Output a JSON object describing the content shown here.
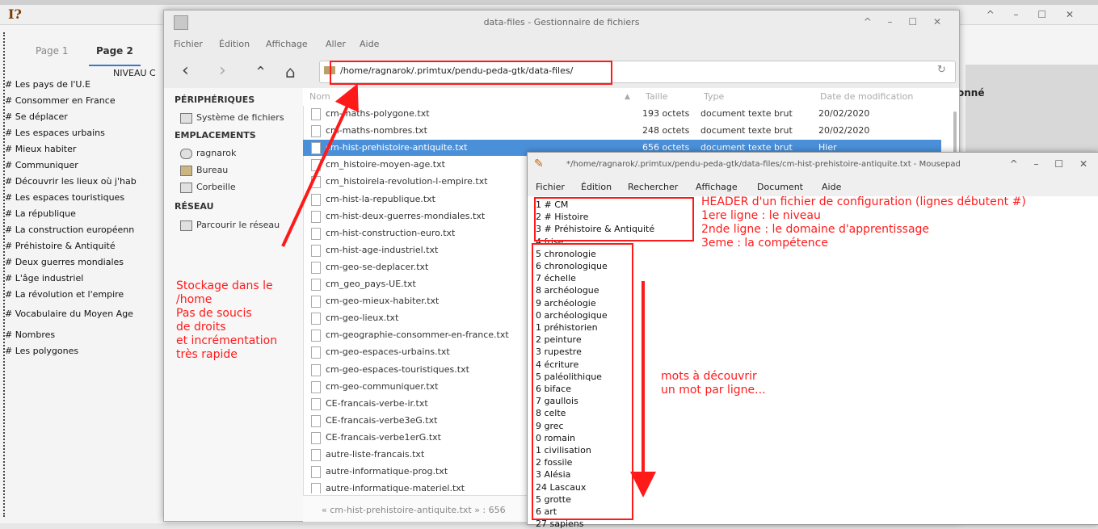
{
  "app": {
    "logo": "I?",
    "controls": "^ – ☐ ✕",
    "tabs": [
      "Page 1",
      "Page 2"
    ],
    "level_label": "NIVEAU C",
    "list_items": [
      "# Les pays de l'U.E",
      "# Consommer en France",
      "# Se déplacer",
      "# Les espaces urbains",
      "# Mieux habiter",
      "# Communiquer",
      "# Découvrir les  lieux où j'hab",
      "# Les espaces touristiques",
      "# La république",
      "# La construction européenn",
      "# Préhistoire & Antiquité",
      "# Deux guerres mondiales",
      "# L'âge industriel",
      "# La révolution et l'empire",
      "# Vocabulaire du Moyen Age",
      "# Nombres",
      "# Les polygones"
    ],
    "right_label": "onné"
  },
  "file_manager": {
    "title": "data-files - Gestionnaire de fichiers",
    "controls": "^ – ☐ ✕",
    "menu": [
      "Fichier",
      "Édition",
      "Affichage",
      "Aller",
      "Aide"
    ],
    "nav": {
      "back": "‹",
      "forward": "›",
      "up": "⌃",
      "home": "⌂"
    },
    "path": "/home/ragnarok/.primtux/pendu-peda-gtk/data-files/",
    "sidebar": {
      "devices_header": "PÉRIPHÉRIQUES",
      "devices": [
        "Système de fichiers"
      ],
      "places_header": "EMPLACEMENTS",
      "places": [
        "ragnarok",
        "Bureau",
        "Corbeille"
      ],
      "network_header": "RÉSEAU",
      "network": [
        "Parcourir le réseau"
      ]
    },
    "columns": [
      "Nom",
      "Taille",
      "Type",
      "Date de modification"
    ],
    "files": [
      {
        "name": "cm-maths-polygone.txt",
        "size": "193 octets",
        "type": "document texte brut",
        "date": "20/02/2020"
      },
      {
        "name": "cm-maths-nombres.txt",
        "size": "248 octets",
        "type": "document texte brut",
        "date": "20/02/2020"
      },
      {
        "name": "cm-hist-prehistoire-antiquite.txt",
        "size": "656 octets",
        "type": "document texte brut",
        "date": "Hier"
      },
      {
        "name": "cm_histoire-moyen-age.txt",
        "size": "",
        "type": "",
        "date": ""
      },
      {
        "name": "cm_histoirela-revolution-l-empire.txt",
        "size": "",
        "type": "",
        "date": ""
      },
      {
        "name": "cm-hist-la-republique.txt",
        "size": "",
        "type": "",
        "date": ""
      },
      {
        "name": "cm-hist-deux-guerres-mondiales.txt",
        "size": "",
        "type": "",
        "date": ""
      },
      {
        "name": "cm-hist-construction-euro.txt",
        "size": "",
        "type": "",
        "date": ""
      },
      {
        "name": "cm-hist-age-industriel.txt",
        "size": "",
        "type": "",
        "date": ""
      },
      {
        "name": "cm-geo-se-deplacer.txt",
        "size": "",
        "type": "",
        "date": ""
      },
      {
        "name": "cm_geo_pays-UE.txt",
        "size": "",
        "type": "",
        "date": ""
      },
      {
        "name": "cm-geo-mieux-habiter.txt",
        "size": "",
        "type": "",
        "date": ""
      },
      {
        "name": "cm-geo-lieux.txt",
        "size": "",
        "type": "",
        "date": ""
      },
      {
        "name": "cm-geographie-consommer-en-france.txt",
        "size": "",
        "type": "",
        "date": ""
      },
      {
        "name": "cm-geo-espaces-urbains.txt",
        "size": "",
        "type": "",
        "date": ""
      },
      {
        "name": "cm-geo-espaces-touristiques.txt",
        "size": "",
        "type": "",
        "date": ""
      },
      {
        "name": "cm-geo-communiquer.txt",
        "size": "",
        "type": "",
        "date": ""
      },
      {
        "name": "CE-francais-verbe-ir.txt",
        "size": "",
        "type": "",
        "date": ""
      },
      {
        "name": "CE-francais-verbe3eG.txt",
        "size": "",
        "type": "",
        "date": ""
      },
      {
        "name": "CE-francais-verbe1erG.txt",
        "size": "",
        "type": "",
        "date": ""
      },
      {
        "name": "autre-liste-francais.txt",
        "size": "",
        "type": "",
        "date": ""
      },
      {
        "name": "autre-informatique-prog.txt",
        "size": "",
        "type": "",
        "date": ""
      },
      {
        "name": "autre-informatique-materiel.txt",
        "size": "",
        "type": "",
        "date": ""
      }
    ],
    "selected_index": 2,
    "status": "« cm-hist-prehistoire-antiquite.txt » : 656"
  },
  "mousepad": {
    "title": "*/home/ragnarok/.primtux/pendu-peda-gtk/data-files/cm-hist-prehistoire-antiquite.txt - Mousepad",
    "controls": "^ – ☐ ✕",
    "menu": [
      "Fichier",
      "Édition",
      "Rechercher",
      "Affichage",
      "Document",
      "Aide"
    ],
    "lines": [
      "1 # CM",
      "2 # Histoire",
      "3 # Préhistoire & Antiquité",
      "4 frise",
      "5 chronologie",
      "6 chronologique",
      "7 échelle",
      "8 archéologue",
      "9 archéologie",
      "0 archéologique",
      "1 préhistorien",
      "2 peinture",
      "3 rupestre",
      "4 écriture",
      "5 paléolithique",
      "6 biface",
      "7 gaullois",
      "8 celte",
      "9 grec",
      "0 romain",
      "1 civilisation",
      "2 fossile",
      "3 Alésia",
      "24 Lascaux",
      "5 grotte",
      "6 art",
      "27 sapiens"
    ]
  },
  "annotations": {
    "storage": [
      "Stockage dans le",
      "/home",
      "Pas de soucis",
      "de droits",
      "et incrémentation",
      "très rapide"
    ],
    "header": [
      "HEADER d'un fichier de configuration (lignes débutent #)",
      "1ere ligne : le niveau",
      "2nde ligne : le domaine d'apprentissage",
      "3eme : la compétence"
    ],
    "words": [
      "mots à découvrir",
      "un mot par ligne..."
    ],
    "color": "#ff1a1a"
  }
}
